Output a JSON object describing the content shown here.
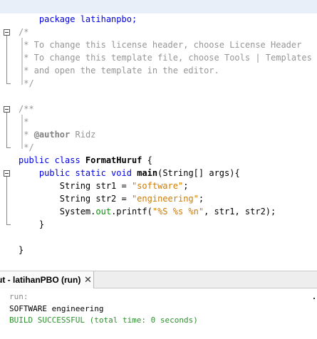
{
  "editor": {
    "package_line": "package latihanpbo;",
    "license_comment": [
      "/*",
      " * To change this license header, choose License Header",
      " * To change this template file, choose Tools | Templates",
      " * and open the template in the editor.",
      " */"
    ],
    "javadoc": {
      "open": "/**",
      "star": " *",
      "author_prefix": " * ",
      "author_tag": "@author",
      "author_name": " Ridz",
      "close": " */"
    },
    "class_decl": {
      "mod": "public class ",
      "name": "FormatHuruf",
      "brace": " {"
    },
    "main_decl": {
      "indent": "    ",
      "mods": "public static void ",
      "name": "main",
      "params": "(String[] args){"
    },
    "str1": {
      "indent": "        ",
      "decl": "String str1 = ",
      "value": "\"software\"",
      "end": ";"
    },
    "str2": {
      "indent": "        ",
      "decl": "String str2 = ",
      "value": "\"engineering\"",
      "end": ";"
    },
    "printf": {
      "indent": "        ",
      "obj": "System.",
      "field": "out",
      "call": ".printf(",
      "fmt": "\"%S %s %n\"",
      "args": ", str1, str2);"
    },
    "close_method": "    }",
    "close_class": "}"
  },
  "output_panel": {
    "tab_title": "ut - latihanPBO (run)",
    "close_glyph": "✕",
    "lines": {
      "run": "run:",
      "result": "SOFTWARE engineering",
      "build": "BUILD SUCCESSFUL (total time: 0 seconds)"
    }
  },
  "icons": {
    "fold": "minus-box-icon",
    "close": "close-icon"
  }
}
